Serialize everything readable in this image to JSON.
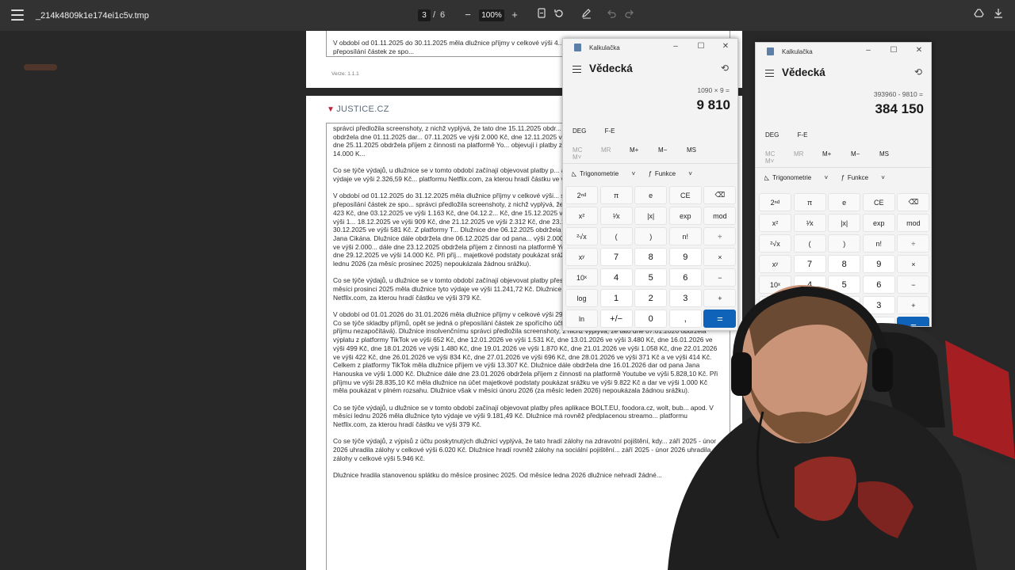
{
  "toolbar": {
    "file_name": "_214k4809k1e174ei1c5v.tmp",
    "page_current": "3",
    "page_separator": "/",
    "page_total": "6",
    "zoom_level": "100%",
    "minus_symbol": "−",
    "plus_symbol": "+"
  },
  "pdf": {
    "page1_paragraph": "V období od 01.11.2025 do 30.11.2025 měla dlužnice příjmy v celkové výši 4... stupně. Co se týče skladby příjmů, opět se jedná o přeposílání částek ze spo...",
    "version": "Verze: 1.1.1",
    "logo_text": "JUSTICE.CZ",
    "paragraphs": [
      "správci předložila screenshoty, z nichž vyplývá, že tato dne 15.11.2025 obdr... dne 30.11.2025 ve výši 2.762 Kč. Dlužnice dále obdržela dne 01.11.2025 dar... 07.11.2025 ve výši 2.000 Kč, dne 12.11.2025 ve výši 3.000 Kč, dne 21.11.2025... Kč. Dlužnice dále dne 25.11.2025 obdržela příjem z činnosti na platformě Yo... objevují i platby z organizace Red Face, a to dne 26.11.2025 ve výši 14.000 K...",
      "Co se týče výdajů, u dlužnice se v tomto období začínají objevovat platby p... apod. V měsíci listopadu 2025 měla dlužnice tyto výdaje ve výši 2.326,59 Kč... platformu Netflix.com, za kterou hradí částku ve výši 379 Kč.",
      "V období od 01.12.2025 do 31.12.2025 měla dlužnice příjmy v celkové výši... stupně. Co se týče skladby příjmů, opět se jedná o přeposílání částek ze spo... správci předložila screenshoty, z nichž vyplývá, že tato dne 01.12.2025 obdr... dne 02.12.2025 ve výši 423 Kč, dne 03.12.2025 ve výši 1.163 Kč, dne 04.12.2... Kč, dne 15.12.2025 ve výši 958 Kč a ve výši 783 Kč, dne 16.12.2025 ve výši 1... 18.12.2025 ve výši 909 Kč, dne 21.12.2025 ve výši 2.312 Kč, dne 23.12.2025 v... dne 29.12.2025 ve výši 553 Kč a dne 30.12.2025 ve výši 581 Kč. Z platformy T... Dlužnice dne 06.12.2025 obdržela dar ve výši 1.000 Kč od pana Petra Hanác... od pana Jana Cikána. Dlužnice dále obdržela dne 06.12.2025 dar od pana... výši 2.000 Kč, dne 12.11.2025 ve výši 3.000 Kč, dne 21.11.2025 ve výši 2.000... dále dne 23.12.2025 obdržela příjem z činnosti na platformě Youtube ve výši... platby z organizace Red Face, a to dne 29.12.2025 ve výši 14.000 Kč. Při příj... majetkové podstaty poukázat srážku ve výši 20.748 Kč a dary ve výši 12.500... v měsíci lednu 2026 (za měsíc prosinec 2025) nepoukázala žádnou srážku).",
      "Co se týče výdajů, u dlužnice se v tomto období začínají objevovat platby přes aplikace BOLT.EU, foodora.cz, wolt, bubblify apod. V měsíci prosinci 2025 měla dlužnice tyto výdaje ve výši 11.241,72 Kč. Dlužnice má rovněž předplacenou streamovací platformu Netflix.com, za kterou hradí částku ve výši 379 Kč.",
      "V období od 01.01.2026 do 31.01.2026 měla dlužnice příjmy v celkové výši 29.835,10 Kč, a to včetně invalidního důchodu I. stupně. Co se týče skladby příjmů, opět se jedná o přeposílání částek ze spořícího účtu dlužnice (tyto insolvenční správce do celkového příjmu nezapočítává). Dlužnice insolvenčnímu správci předložila screenshoty, z nichž vyplývá, že tato dne 07.01.2026 obdržela výplatu z platformy TikTok ve výši 652 Kč, dne 12.01.2026 ve výši 1.531 Kč, dne 13.01.2026 ve výši 3.480 Kč, dne 16.01.2026 ve výši 499 Kč, dne 18.01.2026 ve výši 1.480 Kč, dne 19.01.2026 ve výši 1.870 Kč, dne 21.01.2026 ve výši 1.058 Kč, dne 22.01.2026 ve výši 422 Kč, dne 26.01.2026 ve výši 834 Kč, dne 27.01.2026 ve výši 696 Kč, dne 28.01.2026 ve výši 371 Kč a ve výši 414 Kč. Celkem z platformy TikTok měla dlužnice příjem ve výši 13.307 Kč. Dlužnice dále obdržela dne 16.01.2026 dar od pana Jana Hanouska ve výši 1.000 Kč. Dlužnice dále dne 23.01.2026 obdržela příjem z činnosti na platformě Youtube ve výši 5.828,10 Kč. Při příjmu ve výši 28.835,10 Kč měla dlužnice na účet majetkové podstaty poukázat srážku ve výši 9.822 Kč a dar ve výši 1.000 Kč měla poukázat v plném rozsahu. Dlužnice však v měsíci únoru 2026 (za měsíc leden 2026) nepoukázala žádnou srážku).",
      "Co se týče výdajů, u dlužnice se v tomto období začínají objevovat platby přes aplikace BOLT.EU, foodora.cz, wolt, bub... apod. V měsíci lednu 2026 měla dlužnice tyto výdaje ve výši 9.181,49 Kč. Dlužnice má rovněž předplacenou streamo... platformu Netflix.com, za kterou hradí částku ve výši 379 Kč.",
      "Co se týče výdajů, z výpisů z účtu poskytnutých dlužnicí vyplývá, že tato hradí zálohy na zdravotní pojištění, kdy... září 2025 - únor 2026 uhradila zálohy v celkové výši 6.020 Kč. Dlužnice hradí rovněž zálohy na sociální pojištění... září 2025 - únor 2026 uhradila zálohy v celkové výši 5.946 Kč.",
      "Dlužnice hradila stanovenou splátku do měsíce prosinec 2025. Od měsíce ledna 2026 dlužnice nehradí žádné..."
    ]
  },
  "calc_left": {
    "app_title": "Kalkulačka",
    "mode": "Vědecká",
    "expression": "1090 × 9 =",
    "result": "9 810"
  },
  "calc_right": {
    "app_title": "Kalkulačka",
    "mode": "Vědecká",
    "expression": "393960 - 9810 =",
    "result": "384 150"
  },
  "calc_common": {
    "deg": "DEG",
    "fe": "F-E",
    "memory": [
      "MC",
      "MR",
      "M+",
      "M−",
      "MS",
      "M˅"
    ],
    "trig": "Trigonometrie",
    "func": "Funkce",
    "keys": [
      "2ⁿᵈ",
      "π",
      "e",
      "CE",
      "⌫",
      "x²",
      "¹⁄x",
      "|x|",
      "exp",
      "mod",
      "²√x",
      "(",
      ")",
      "n!",
      "÷",
      "xʸ",
      "7",
      "8",
      "9",
      "×",
      "10ˣ",
      "4",
      "5",
      "6",
      "−",
      "log",
      "1",
      "2",
      "3",
      "+",
      "ln",
      "+/−",
      "0",
      ",",
      "="
    ]
  },
  "colors": {
    "equals_button": "#0f63b9",
    "toolbar_bg": "#323232",
    "background": "#282828"
  }
}
